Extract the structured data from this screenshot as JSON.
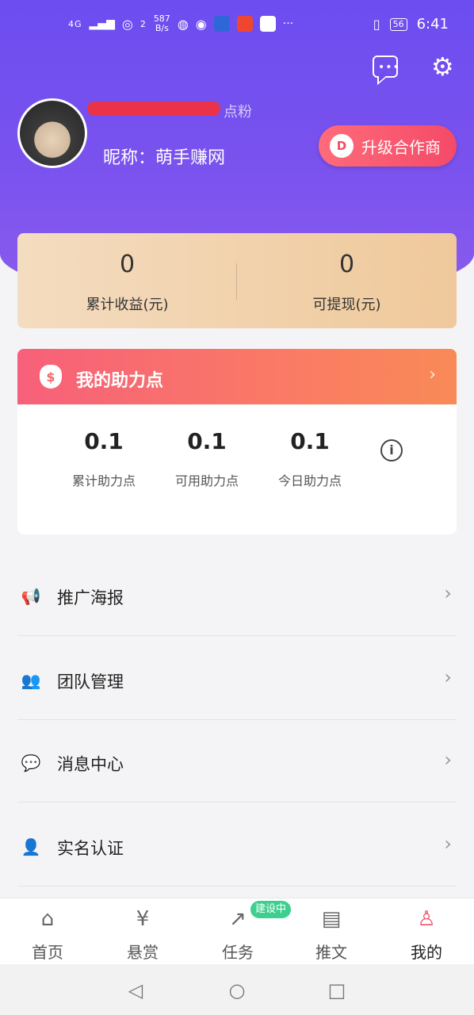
{
  "status_bar": {
    "signal": "4G",
    "wifi_count": "2",
    "speed": "587\nB/s",
    "speed_value": "587",
    "speed_unit": "B/s",
    "more": "···",
    "battery": "56",
    "time": "6:41"
  },
  "header": {
    "fans_label": "点粉",
    "nickname": "昵称：萌手赚网",
    "upgrade_label": "升级合作商",
    "upgrade_icon_glyph": "D"
  },
  "earnings": {
    "total": {
      "value": "0",
      "label": "累计收益(元)"
    },
    "withdrawable": {
      "value": "0",
      "label": "可提现(元)"
    }
  },
  "points": {
    "title": "我的助力点",
    "icon_glyph": "$",
    "arrow": "›",
    "items": [
      {
        "value": "0.1",
        "label": "累计助力点"
      },
      {
        "value": "0.1",
        "label": "可用助力点"
      },
      {
        "value": "0.1",
        "label": "今日助力点"
      }
    ],
    "info_glyph": "i"
  },
  "menu": [
    {
      "label": "推广海报",
      "icon": "megaphone-icon",
      "color": "#f26b4f"
    },
    {
      "label": "团队管理",
      "icon": "team-icon",
      "color": "#5d74e6"
    },
    {
      "label": "消息中心",
      "icon": "message-icon",
      "color": "#3aa6e9"
    },
    {
      "label": "实名认证",
      "icon": "id-card-icon",
      "color": "#f29a4b"
    }
  ],
  "menu_chevron": "›",
  "tabs": [
    {
      "label": "首页",
      "icon": "home-icon"
    },
    {
      "label": "悬赏",
      "icon": "moneybag-icon"
    },
    {
      "label": "任务",
      "icon": "share-icon"
    },
    {
      "label": "推文",
      "icon": "document-icon"
    },
    {
      "label": "我的",
      "icon": "user-icon",
      "active": true
    }
  ],
  "task_badge": "建设中",
  "colors": {
    "hero": "#6c4df0",
    "accent": "#f0536a",
    "badge": "#3ccf8e"
  }
}
